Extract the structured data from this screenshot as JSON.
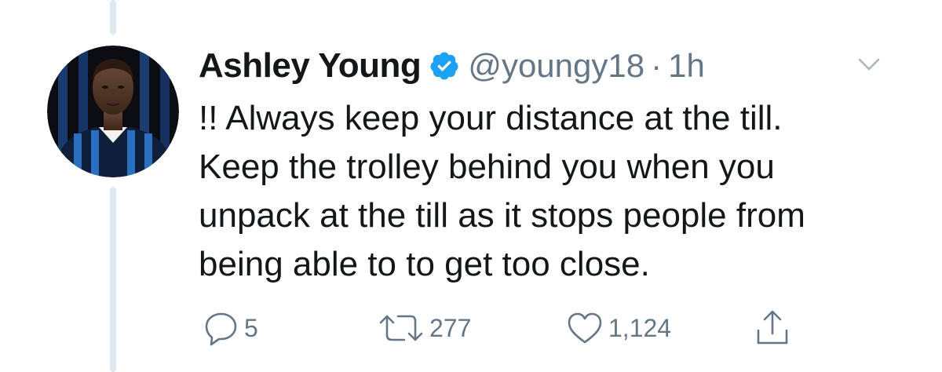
{
  "tweet": {
    "author": {
      "display_name": "Ashley Young",
      "handle": "@youngy18",
      "verified": true,
      "avatar_icon": "profile-photo"
    },
    "separator": "·",
    "time": "1h",
    "text": "!! Always keep your distance at the till.\nKeep the trolley behind you when you\nunpack at the till as it stops people from\nbeing able to to get too close.",
    "actions": {
      "reply_count": "5",
      "retweet_count": "277",
      "like_count": "1,124"
    }
  },
  "colors": {
    "text_primary": "#14171a",
    "text_secondary": "#657786",
    "verified_blue": "#1da1f2",
    "thread_line": "#e1e8ed"
  },
  "icons": {
    "menu": "chevron-down-icon",
    "reply": "reply-icon",
    "retweet": "retweet-icon",
    "like": "heart-icon",
    "share": "share-icon",
    "verified": "verified-badge-icon"
  }
}
